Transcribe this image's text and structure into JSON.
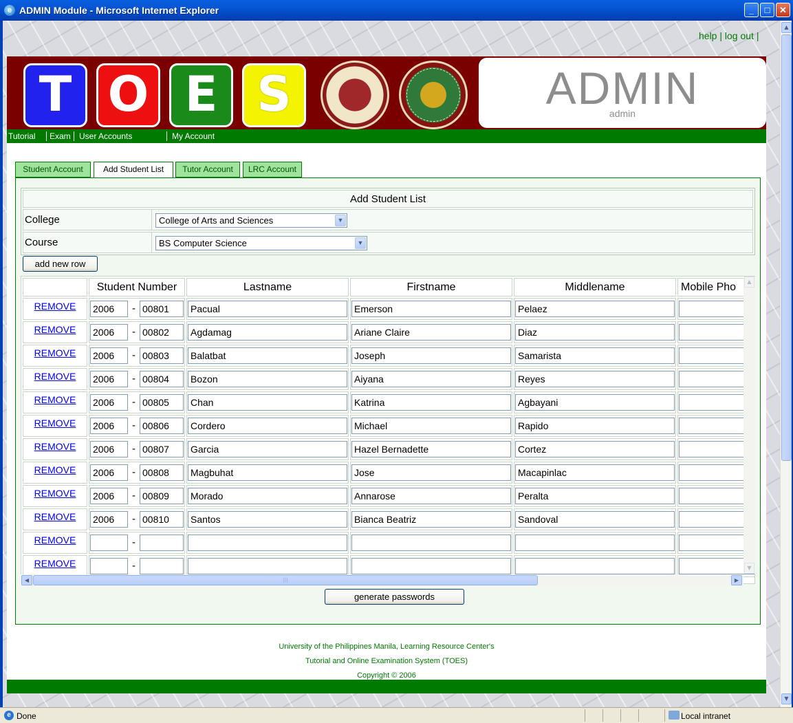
{
  "window": {
    "title": "ADMIN Module - Microsoft Internet Explorer",
    "minimize_glyph": "_",
    "maximize_glyph": "□",
    "close_glyph": "✕"
  },
  "top_links": {
    "help": "help",
    "separator": "|",
    "logout": "log out",
    "trailing": "|"
  },
  "banner": {
    "tiles": [
      "T",
      "O",
      "E",
      "S"
    ],
    "tile_colors": [
      "#2222ee",
      "#ee1010",
      "#1a8a1a",
      "#f4f400"
    ],
    "admin_title": "ADMIN",
    "admin_user": "admin"
  },
  "nav": {
    "items": [
      "Tutorial",
      "Exam",
      "User Accounts",
      "My Account"
    ],
    "active": "User Accounts"
  },
  "tabs": {
    "items": [
      "Student Account",
      "Add Student List",
      "Tutor Account",
      "LRC Account"
    ],
    "selected": "Add Student List"
  },
  "form": {
    "heading": "Add Student List",
    "college_label": "College",
    "college_value": "College of Arts and Sciences",
    "course_label": "Course",
    "course_value": "BS Computer Science",
    "add_row_button": "add new row",
    "generate_button": "generate passwords"
  },
  "grid": {
    "headers": [
      "",
      "Student Number",
      "Lastname",
      "Firstname",
      "Middlename",
      "Mobile Pho"
    ],
    "remove_label": "REMOVE",
    "dash": "-",
    "rows": [
      {
        "year": "2006",
        "num": "00801",
        "last": "Pacual",
        "first": "Emerson",
        "middle": "Pelaez",
        "mobile": ""
      },
      {
        "year": "2006",
        "num": "00802",
        "last": "Agdamag",
        "first": "Ariane Claire",
        "middle": "Diaz",
        "mobile": ""
      },
      {
        "year": "2006",
        "num": "00803",
        "last": "Balatbat",
        "first": "Joseph",
        "middle": "Samarista",
        "mobile": ""
      },
      {
        "year": "2006",
        "num": "00804",
        "last": "Bozon",
        "first": "Aiyana",
        "middle": "Reyes",
        "mobile": ""
      },
      {
        "year": "2006",
        "num": "00805",
        "last": "Chan",
        "first": "Katrina",
        "middle": "Agbayani",
        "mobile": ""
      },
      {
        "year": "2006",
        "num": "00806",
        "last": "Cordero",
        "first": "Michael",
        "middle": "Rapido",
        "mobile": ""
      },
      {
        "year": "2006",
        "num": "00807",
        "last": "Garcia",
        "first": "Hazel Bernadette",
        "middle": "Cortez",
        "mobile": ""
      },
      {
        "year": "2006",
        "num": "00808",
        "last": "Magbuhat",
        "first": "Jose",
        "middle": "Macapinlac",
        "mobile": ""
      },
      {
        "year": "2006",
        "num": "00809",
        "last": "Morado",
        "first": "Annarose",
        "middle": "Peralta",
        "mobile": ""
      },
      {
        "year": "2006",
        "num": "00810",
        "last": "Santos",
        "first": "Bianca Beatriz",
        "middle": "Sandoval",
        "mobile": ""
      },
      {
        "year": "",
        "num": "",
        "last": "",
        "first": "",
        "middle": "",
        "mobile": ""
      },
      {
        "year": "",
        "num": "",
        "last": "",
        "first": "",
        "middle": "",
        "mobile": ""
      }
    ]
  },
  "footer": {
    "line1": "University of the Philippines Manila, Learning Resource Center's",
    "line2": "Tutorial and Online Examination System (TOES)",
    "line3": "Copyright © 2006"
  },
  "statusbar": {
    "status": "Done",
    "zone": "Local intranet"
  },
  "icons": {
    "app": "ie-icon",
    "dropdown": "chevron-down-icon",
    "scroll_up": "arrow-up-icon",
    "scroll_down": "arrow-down-icon",
    "scroll_left": "arrow-left-icon",
    "scroll_right": "arrow-right-icon"
  },
  "colors": {
    "brand_green": "#007a00",
    "banner_maroon": "#7a0000",
    "link_blue": "#0000ee",
    "xp_title_blue": "#0654d2"
  }
}
